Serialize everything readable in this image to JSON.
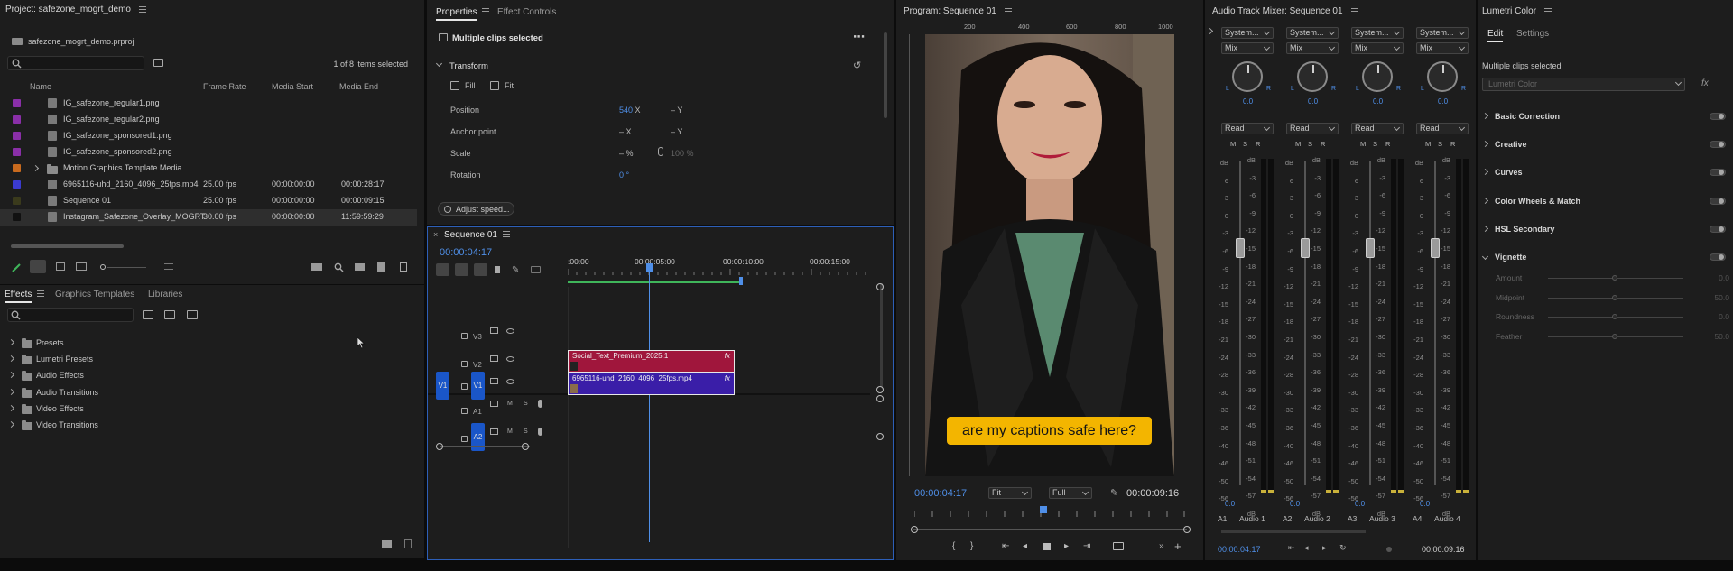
{
  "project": {
    "title": "Project: safezone_mogrt_demo",
    "file": "safezone_mogrt_demo.prproj",
    "selection": "1 of 8 items selected",
    "columns": [
      "Name",
      "Frame Rate",
      "Media Start",
      "Media End"
    ],
    "items": [
      {
        "name": "IG_safezone_regular1.png",
        "fr": "",
        "ms": "",
        "me": "",
        "color": "#8a2fa8",
        "kind": "file"
      },
      {
        "name": "IG_safezone_regular2.png",
        "fr": "",
        "ms": "",
        "me": "",
        "color": "#8a2fa8",
        "kind": "file"
      },
      {
        "name": "IG_safezone_sponsored1.png",
        "fr": "",
        "ms": "",
        "me": "",
        "color": "#8a2fa8",
        "kind": "file"
      },
      {
        "name": "IG_safezone_sponsored2.png",
        "fr": "",
        "ms": "",
        "me": "",
        "color": "#8a2fa8",
        "kind": "file"
      },
      {
        "name": "Motion Graphics Template Media",
        "fr": "",
        "ms": "",
        "me": "",
        "color": "#c86a1e",
        "kind": "folder"
      },
      {
        "name": "6965116-uhd_2160_4096_25fps.mp4",
        "fr": "25.00 fps",
        "ms": "00:00:00:00",
        "me": "00:00:28:17",
        "color": "#3b3bd0",
        "kind": "video"
      },
      {
        "name": "Sequence 01",
        "fr": "25.00 fps",
        "ms": "00:00:00:00",
        "me": "00:00:09:15",
        "color": "#3a3a1c",
        "kind": "sequence"
      },
      {
        "name": "Instagram_Safezone_Overlay_MOGRT",
        "fr": "30.00 fps",
        "ms": "00:00:00:00",
        "me": "11:59:59:29",
        "color": "#111111",
        "kind": "mogrt"
      }
    ]
  },
  "effects": {
    "tabs": [
      "Effects",
      "Graphics Templates",
      "Libraries"
    ],
    "items": [
      "Presets",
      "Lumetri Presets",
      "Audio Effects",
      "Audio Transitions",
      "Video Effects",
      "Video Transitions"
    ]
  },
  "properties": {
    "tabs": [
      "Properties",
      "Effect Controls"
    ],
    "header": "Multiple clips selected",
    "section": "Transform",
    "fill": "Fill",
    "fit": "Fit",
    "position": {
      "label": "Position",
      "x": "540",
      "x_unit": "X",
      "y": "– Y"
    },
    "anchor": {
      "label": "Anchor point",
      "x": "– X",
      "y": "– Y"
    },
    "scale": {
      "label": "Scale",
      "v": "– %",
      "v2": "100 %"
    },
    "rotation": {
      "label": "Rotation",
      "v": "0 °"
    },
    "adjust_speed": "Adjust speed..."
  },
  "sequence": {
    "title": "Sequence 01",
    "timecode": "00:00:04:17",
    "ruler": [
      ":00:00",
      "00:00:05:00",
      "00:00:10:00",
      "00:00:15:00"
    ],
    "tracks": [
      "V3",
      "V2",
      "V1",
      "A1",
      "A2"
    ],
    "clip_v2": "Social_Text_Premium_2025.1",
    "clip_v1": "6965116-uhd_2160_4096_25fps.mp4",
    "fx": "fx",
    "ms": [
      "M",
      "S"
    ]
  },
  "program": {
    "title": "Program: Sequence 01",
    "ruler": [
      "200",
      "400",
      "600",
      "800",
      "1000"
    ],
    "caption": "are my captions safe here?",
    "timecode": "00:00:04:17",
    "fit": "Fit",
    "full": "Full",
    "duration": "00:00:09:16"
  },
  "mixer": {
    "title": "Audio Track Mixer: Sequence 01",
    "channels": [
      {
        "output": "System...",
        "mode": "Read",
        "value": "0.0",
        "label": "Audio 1",
        "id": "A1"
      },
      {
        "output": "System...",
        "mode": "Read",
        "value": "0.0",
        "label": "Audio 2",
        "id": "A2"
      },
      {
        "output": "System...",
        "mode": "Read",
        "value": "0.0",
        "label": "Audio 3",
        "id": "A3"
      },
      {
        "output": "System...",
        "mode": "Read",
        "value": "0.0",
        "label": "Audio 4",
        "id": "A4"
      }
    ],
    "mix": "Mix",
    "lr": [
      "L",
      "R"
    ],
    "mrs": [
      "M",
      "S",
      "R"
    ],
    "db_scale": [
      "dB",
      "-3",
      "-6",
      "-9",
      "-12",
      "-15",
      "-18",
      "-21",
      "-24",
      "-27",
      "-30",
      "-33",
      "-36",
      "-39",
      "-42",
      "-45",
      "-48",
      "-51",
      "-54",
      "-57",
      "dB"
    ],
    "fader_scale": [
      "dB",
      "6",
      "3",
      "0",
      "-3",
      "-6",
      "-9",
      "-12",
      "-15",
      "-18",
      "-21",
      "-24",
      "-28",
      "-30",
      "-33",
      "-36",
      "-40",
      "-46",
      "-50",
      "-56"
    ],
    "timecode": "00:00:04:17",
    "duration": "00:00:09:16"
  },
  "lumetri": {
    "title": "Lumetri Color",
    "tabs": [
      "Edit",
      "Settings"
    ],
    "selected": "Multiple clips selected",
    "dropdown": "Lumetri Color",
    "fx": "fx",
    "sections": [
      "Basic Correction",
      "Creative",
      "Curves",
      "Color Wheels & Match",
      "HSL Secondary",
      "Vignette"
    ],
    "vignette": [
      {
        "label": "Amount",
        "value": "0.0"
      },
      {
        "label": "Midpoint",
        "value": "50.0"
      },
      {
        "label": "Roundness",
        "value": "0.0"
      },
      {
        "label": "Feather",
        "value": "50.0"
      }
    ]
  },
  "colors": {
    "accent": "#4f8fe8",
    "clip_v2": "#a0163c",
    "clip_v1": "#3a1ea8",
    "caption_bg": "#f3b500",
    "panel": "#1d1d1d"
  }
}
